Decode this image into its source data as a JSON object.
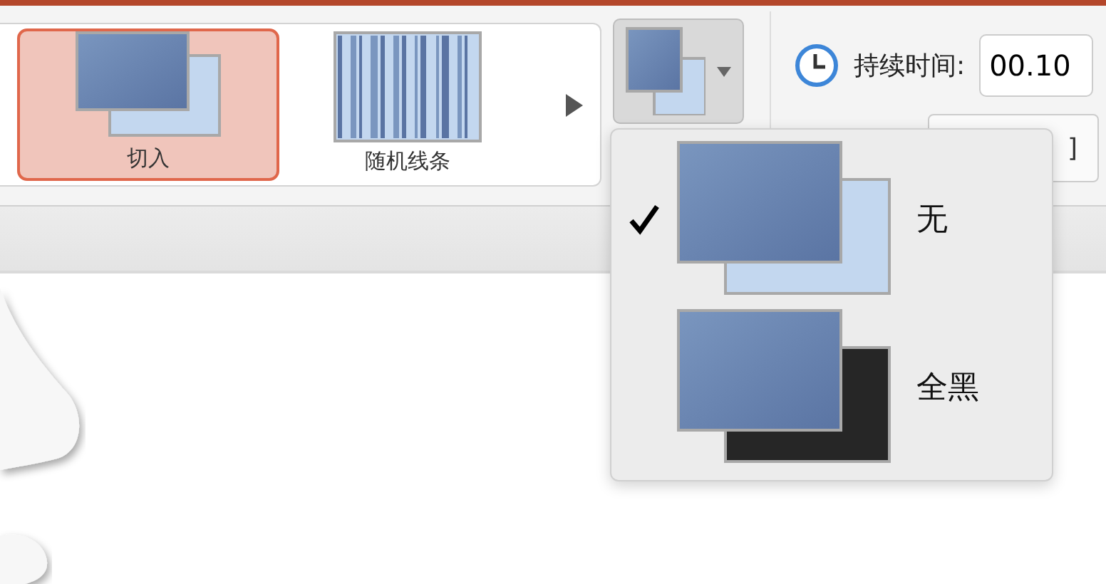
{
  "gallery": {
    "items": [
      {
        "label": "切入",
        "kind": "cut",
        "selected": true
      },
      {
        "label": "随机线条",
        "kind": "lines",
        "selected": false
      }
    ]
  },
  "duration": {
    "label": "持续时间:",
    "value": "00.10"
  },
  "sound_button": {
    "label": "]"
  },
  "effect_options_menu": {
    "items": [
      {
        "label": "无",
        "kind": "none",
        "checked": true
      },
      {
        "label": "全黑",
        "kind": "black",
        "checked": false
      }
    ]
  }
}
